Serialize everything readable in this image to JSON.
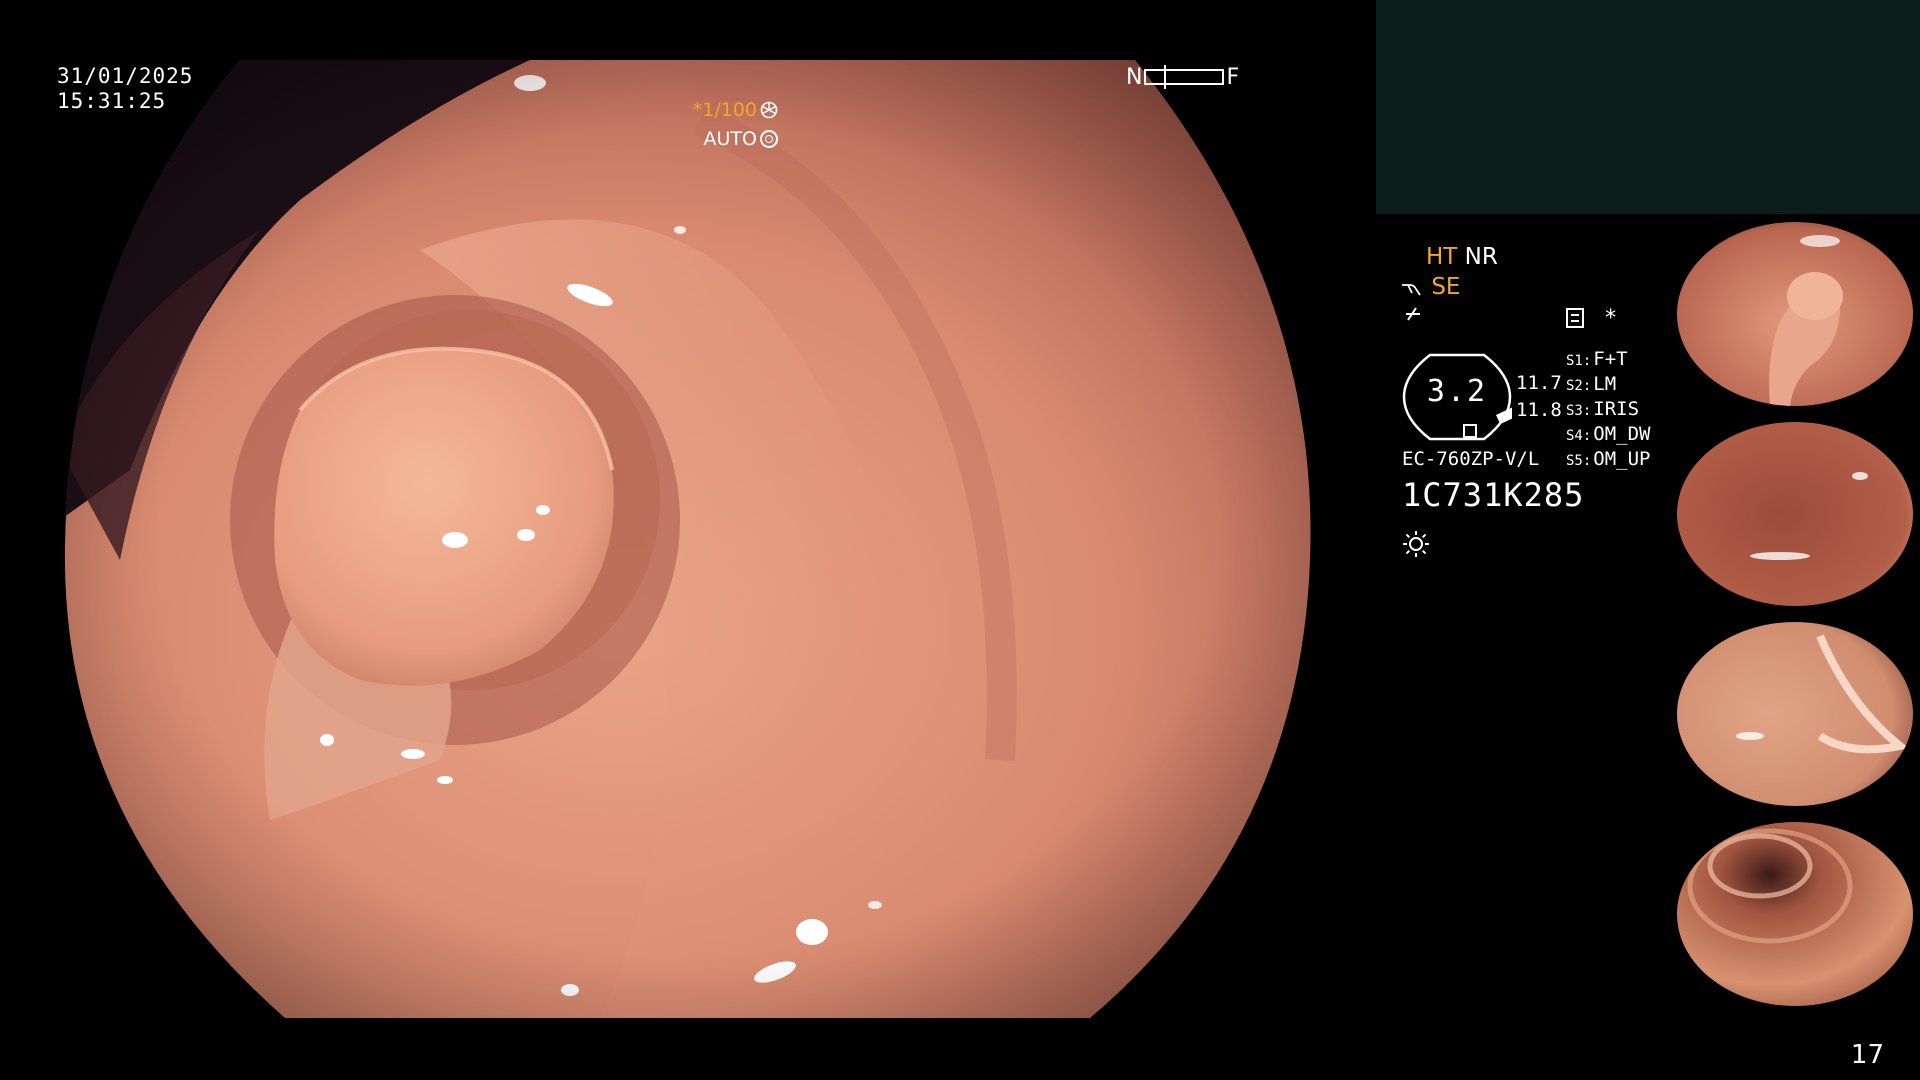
{
  "overlay": {
    "date": "31/01/2025",
    "time": "15:31:25",
    "near_label": "N",
    "far_label": "F",
    "shutter": "*1/100",
    "iris_mode": "AUTO"
  },
  "panel": {
    "mode_ht": "HT",
    "mode_nr": "NR",
    "mode_se": "SE",
    "dial_value": "3.2",
    "dial_side_top": "11.7",
    "dial_side_bottom": "11.8",
    "asterisk": "*",
    "presets": [
      {
        "key": "S1:",
        "label": "F+T"
      },
      {
        "key": "S2:",
        "label": "LM"
      },
      {
        "key": "S3:",
        "label": "IRIS"
      },
      {
        "key": "S4:",
        "label": "OM_DW"
      },
      {
        "key": "S5:",
        "label": "OM_UP"
      }
    ],
    "scope_model": "EC-760ZP-V/L",
    "serial_number": "1C731K285"
  },
  "page_number": "17",
  "colors": {
    "accent_orange": "#f5a623",
    "panel_dark_teal": "#0c1d1b",
    "mucosa": "#d98a70"
  },
  "icons": {
    "shutter": "shutter-icon",
    "iris": "iris-icon",
    "enhancement": "enhancement-icon",
    "structure": "structure-enhance-icon",
    "freeze": "list-icon",
    "light": "sun-icon"
  }
}
